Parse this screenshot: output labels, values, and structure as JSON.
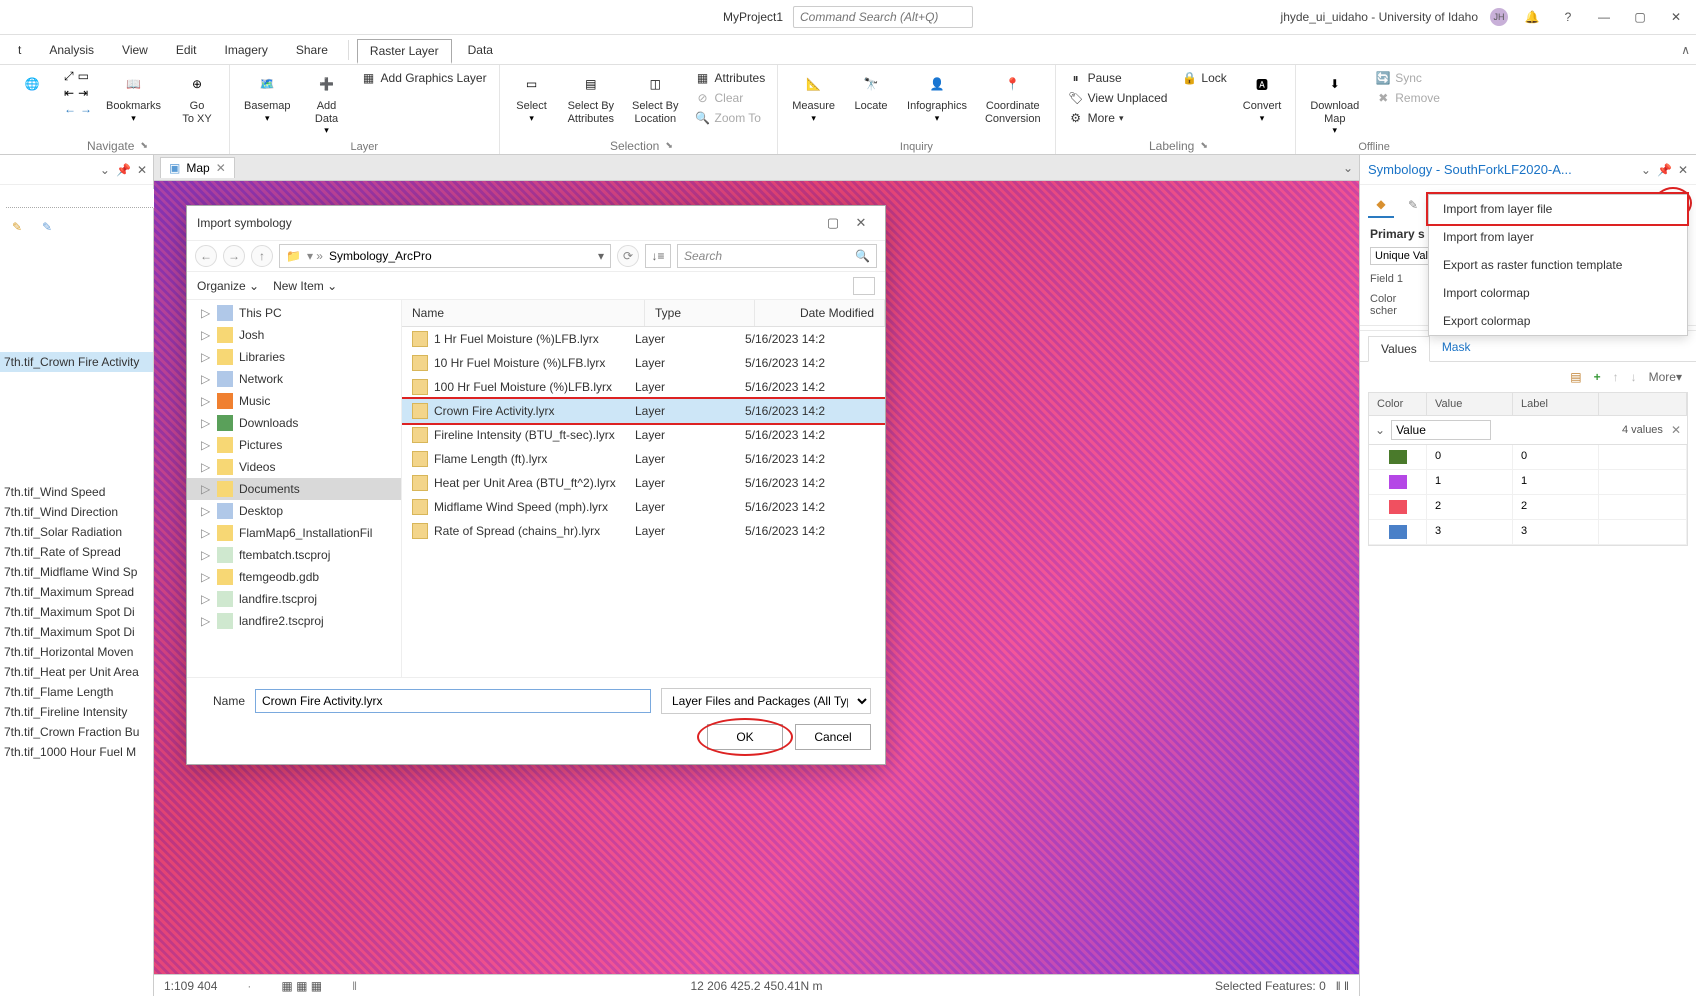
{
  "titlebar": {
    "project_name": "MyProject1",
    "command_search_placeholder": "Command Search (Alt+Q)",
    "user": "jhyde_ui_uidaho - University of Idaho",
    "user_initials": "JH"
  },
  "menubar": {
    "items": [
      "t",
      "Analysis",
      "View",
      "Edit",
      "Imagery",
      "Share"
    ],
    "contextual": [
      "Raster Layer",
      "Data"
    ]
  },
  "ribbon": {
    "navigate": {
      "label": "Navigate",
      "bookmarks": "Bookmarks",
      "goto": "Go\nTo XY"
    },
    "layer": {
      "label": "Layer",
      "basemap": "Basemap",
      "adddata": "Add\nData",
      "addgraphics": "Add Graphics Layer"
    },
    "selection": {
      "label": "Selection",
      "select": "Select",
      "selbyattr": "Select By\nAttributes",
      "selbyloc": "Select By\nLocation",
      "attributes": "Attributes",
      "clear": "Clear",
      "zoomto": "Zoom To"
    },
    "inquiry": {
      "label": "Inquiry",
      "measure": "Measure",
      "locate": "Locate",
      "infographics": "Infographics",
      "coord": "Coordinate\nConversion"
    },
    "labeling": {
      "label": "Labeling",
      "pause": "Pause",
      "lock": "Lock",
      "viewunplaced": "View Unplaced",
      "more": "More",
      "convert": "Convert"
    },
    "offline": {
      "label": "Offline",
      "download": "Download\nMap",
      "sync": "Sync",
      "remove": "Remove"
    }
  },
  "toc": {
    "selected": "7th.tif_Crown Fire Activity",
    "items": [
      "7th.tif_Crown Fire Activity",
      "7th.tif_Wind Speed",
      "7th.tif_Wind Direction",
      "7th.tif_Solar Radiation",
      "7th.tif_Rate of Spread",
      "7th.tif_Midflame Wind Sp",
      "7th.tif_Maximum Spread",
      "7th.tif_Maximum Spot Di",
      "7th.tif_Maximum Spot Di",
      "7th.tif_Horizontal Moven",
      "7th.tif_Heat per Unit Area",
      "7th.tif_Flame Length",
      "7th.tif_Fireline Intensity",
      "7th.tif_Crown Fraction Bu",
      "7th.tif_1000 Hour Fuel M"
    ]
  },
  "map": {
    "tab_label": "Map",
    "scale": "1:109 404",
    "coords": "12 206 425.2 450.41N m",
    "sel_features": "Selected Features: 0"
  },
  "symbology": {
    "title": "Symbology - SouthForkLF2020-A...",
    "primary_label": "Primary s",
    "renderer": "Unique Val",
    "field_label": "Field 1",
    "color_label": "Color scher",
    "tabs": {
      "values": "Values",
      "mask": "Mask"
    },
    "more": "More",
    "columns": {
      "color": "Color",
      "value": "Value",
      "label": "Label"
    },
    "group_field": "Value",
    "count": "4 values",
    "rows": [
      {
        "color": "#4a7a2b",
        "value": "0",
        "label": "0"
      },
      {
        "color": "#b547e6",
        "value": "1",
        "label": "1"
      },
      {
        "color": "#f05060",
        "value": "2",
        "label": "2"
      },
      {
        "color": "#4a80c8",
        "value": "3",
        "label": "3"
      }
    ]
  },
  "context_menu": {
    "items": [
      "Import from layer file",
      "Import from layer",
      "Export as raster function template",
      "Import colormap",
      "Export colormap"
    ]
  },
  "dialog": {
    "title": "Import symbology",
    "path": "Symbology_ArcPro",
    "search_placeholder": "Search",
    "organize": "Organize",
    "new_item": "New Item",
    "tree": [
      {
        "label": "This PC",
        "icon": "disk"
      },
      {
        "label": "Josh",
        "icon": "folder"
      },
      {
        "label": "Libraries",
        "icon": "folder"
      },
      {
        "label": "Network",
        "icon": "disk"
      },
      {
        "label": "Music",
        "icon": "music"
      },
      {
        "label": "Downloads",
        "icon": "dl"
      },
      {
        "label": "Pictures",
        "icon": "folder"
      },
      {
        "label": "Videos",
        "icon": "folder"
      },
      {
        "label": "Documents",
        "icon": "doc",
        "selected": true
      },
      {
        "label": "Desktop",
        "icon": "disk"
      },
      {
        "label": "FlamMap6_InstallationFil",
        "icon": "folder"
      },
      {
        "label": "ftembatch.tscproj",
        "icon": "proj"
      },
      {
        "label": "ftemgeodb.gdb",
        "icon": "folder"
      },
      {
        "label": "landfire.tscproj",
        "icon": "proj"
      },
      {
        "label": "landfire2.tscproj",
        "icon": "proj"
      }
    ],
    "columns": {
      "name": "Name",
      "type": "Type",
      "date": "Date Modified"
    },
    "files": [
      {
        "name": "1 Hr Fuel Moisture (%)LFB.lyrx",
        "type": "Layer",
        "date": "5/16/2023 14:2"
      },
      {
        "name": "10 Hr Fuel Moisture (%)LFB.lyrx",
        "type": "Layer",
        "date": "5/16/2023 14:2"
      },
      {
        "name": "100 Hr Fuel Moisture (%)LFB.lyrx",
        "type": "Layer",
        "date": "5/16/2023 14:2"
      },
      {
        "name": "Crown Fire Activity.lyrx",
        "type": "Layer",
        "date": "5/16/2023 14:2",
        "selected": true
      },
      {
        "name": "Fireline Intensity (BTU_ft-sec).lyrx",
        "type": "Layer",
        "date": "5/16/2023 14:2"
      },
      {
        "name": "Flame Length (ft).lyrx",
        "type": "Layer",
        "date": "5/16/2023 14:2"
      },
      {
        "name": "Heat per Unit Area (BTU_ft^2).lyrx",
        "type": "Layer",
        "date": "5/16/2023 14:2"
      },
      {
        "name": "Midflame Wind Speed (mph).lyrx",
        "type": "Layer",
        "date": "5/16/2023 14:2"
      },
      {
        "name": "Rate of Spread (chains_hr).lyrx",
        "type": "Layer",
        "date": "5/16/2023 14:2"
      }
    ],
    "name_label": "Name",
    "name_value": "Crown Fire Activity.lyrx",
    "type_filter": "Layer Files and Packages (All Types",
    "ok": "OK",
    "cancel": "Cancel"
  }
}
